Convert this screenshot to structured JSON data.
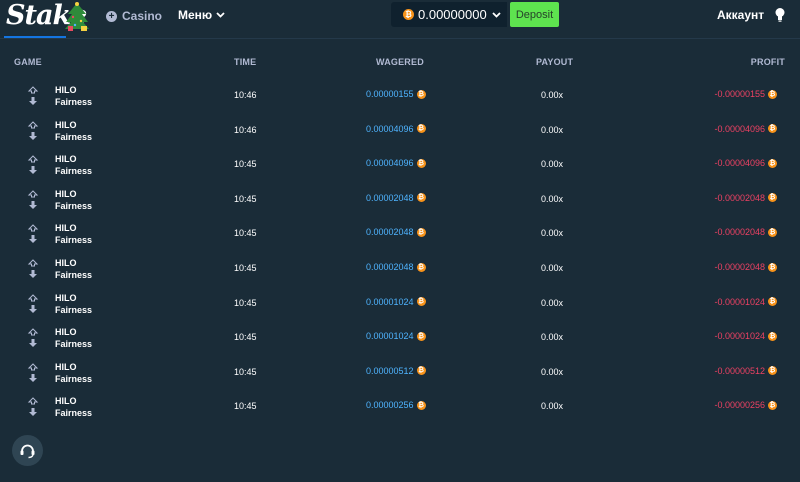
{
  "header": {
    "logo_text": "Stake",
    "casino_label": "Casino",
    "menu_label": "Меню",
    "wallet_balance": "0.00000000",
    "currency_symbol": "₿",
    "deposit_label": "Deposit",
    "account_label": "Аккаунт"
  },
  "table": {
    "columns": {
      "game": "GAME",
      "time": "TIME",
      "wagered": "WAGERED",
      "payout": "PAYOUT",
      "profit": "PROFIT"
    },
    "rows": [
      {
        "game": "HILO",
        "sub": "Fairness",
        "time": "10:46",
        "wagered": "0.00000155",
        "payout": "0.00x",
        "profit": "-0.00000155"
      },
      {
        "game": "HILO",
        "sub": "Fairness",
        "time": "10:46",
        "wagered": "0.00004096",
        "payout": "0.00x",
        "profit": "-0.00004096"
      },
      {
        "game": "HILO",
        "sub": "Fairness",
        "time": "10:45",
        "wagered": "0.00004096",
        "payout": "0.00x",
        "profit": "-0.00004096"
      },
      {
        "game": "HILO",
        "sub": "Fairness",
        "time": "10:45",
        "wagered": "0.00002048",
        "payout": "0.00x",
        "profit": "-0.00002048"
      },
      {
        "game": "HILO",
        "sub": "Fairness",
        "time": "10:45",
        "wagered": "0.00002048",
        "payout": "0.00x",
        "profit": "-0.00002048"
      },
      {
        "game": "HILO",
        "sub": "Fairness",
        "time": "10:45",
        "wagered": "0.00002048",
        "payout": "0.00x",
        "profit": "-0.00002048"
      },
      {
        "game": "HILO",
        "sub": "Fairness",
        "time": "10:45",
        "wagered": "0.00001024",
        "payout": "0.00x",
        "profit": "-0.00001024"
      },
      {
        "game": "HILO",
        "sub": "Fairness",
        "time": "10:45",
        "wagered": "0.00001024",
        "payout": "0.00x",
        "profit": "-0.00001024"
      },
      {
        "game": "HILO",
        "sub": "Fairness",
        "time": "10:45",
        "wagered": "0.00000512",
        "payout": "0.00x",
        "profit": "-0.00000512"
      },
      {
        "game": "HILO",
        "sub": "Fairness",
        "time": "10:45",
        "wagered": "0.00000256",
        "payout": "0.00x",
        "profit": "-0.00000256"
      }
    ]
  },
  "colors": {
    "background": "#1a2c38",
    "wagered_text": "#4fb4ff",
    "profit_negative": "#ed4163",
    "deposit_button": "#5ee34f",
    "bitcoin": "#f7931a"
  },
  "icons": {
    "casino": "plus-circle-icon",
    "menu_chevron": "chevron-down-icon",
    "currency": "bitcoin-icon",
    "account": "lightbulb-icon",
    "game": "hilo-game-icon",
    "support": "headset-icon",
    "decoration": "christmas-tree-icon"
  }
}
